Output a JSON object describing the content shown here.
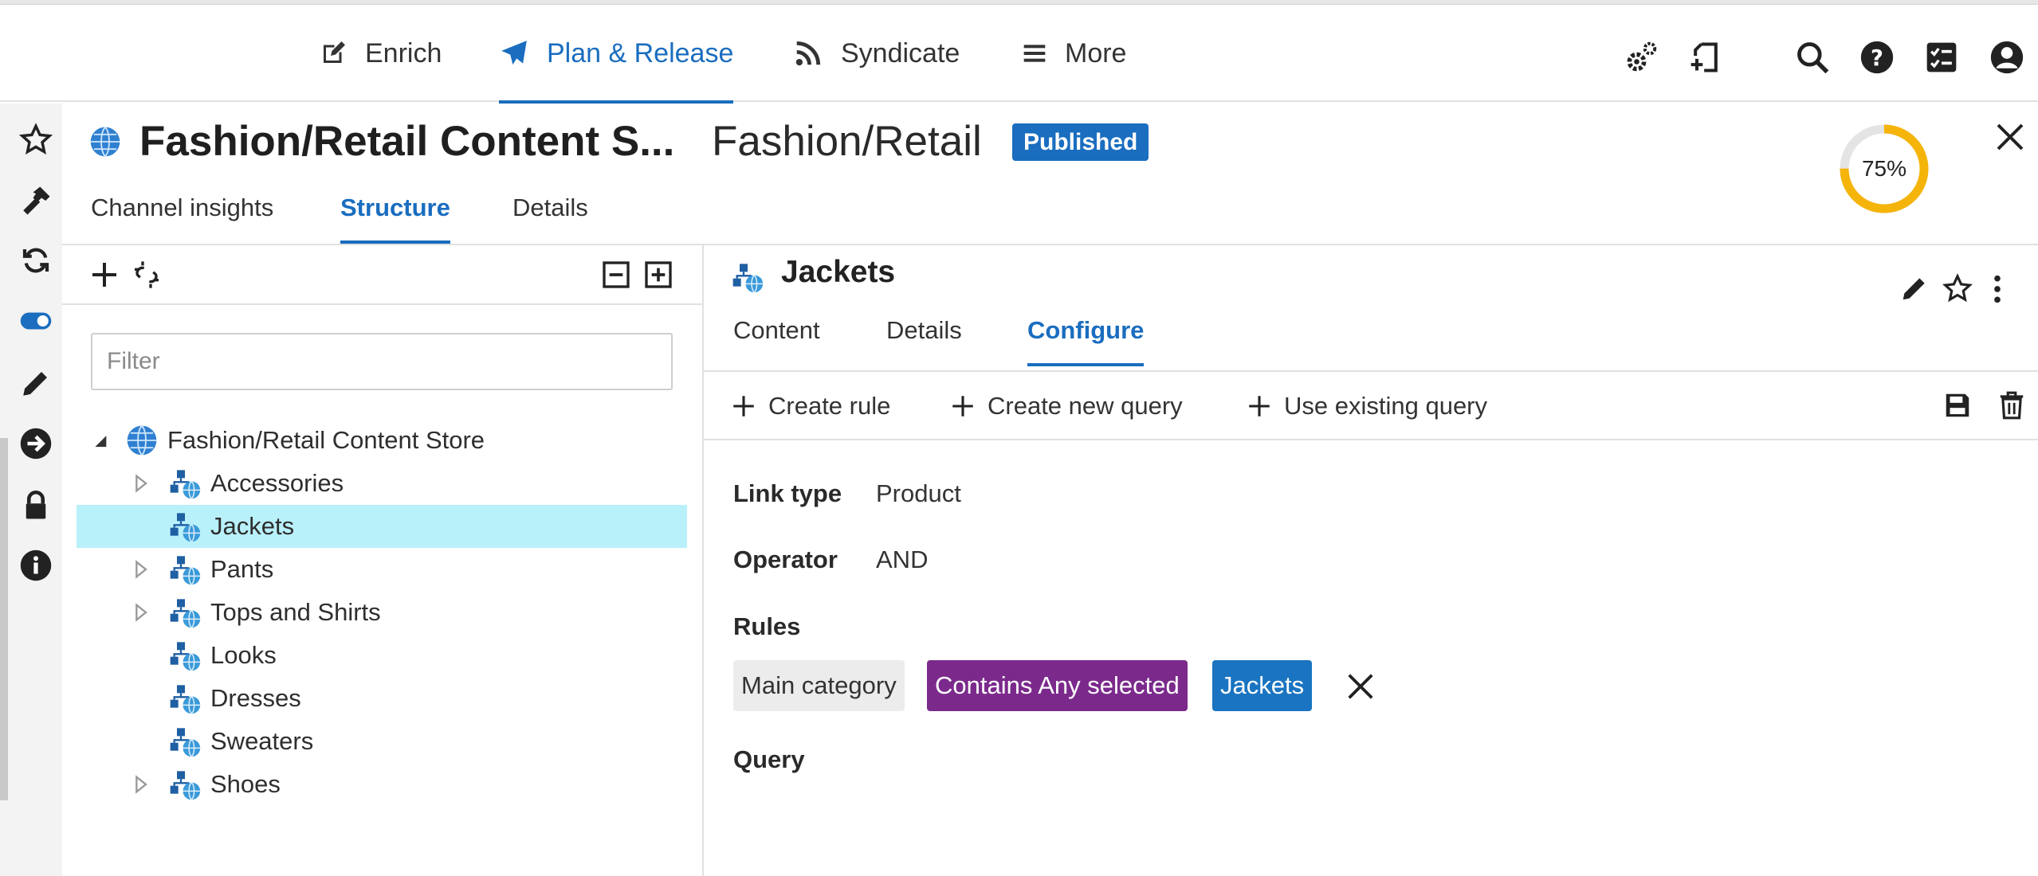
{
  "topnav": {
    "items": [
      {
        "label": "Enrich",
        "icon": "edit-square-icon",
        "active": false
      },
      {
        "label": "Plan & Release",
        "icon": "paper-plane-icon",
        "active": true
      },
      {
        "label": "Syndicate",
        "icon": "rss-icon",
        "active": false
      },
      {
        "label": "More",
        "icon": "hamburger-menu-icon",
        "active": false
      }
    ],
    "utilities": [
      "gears-icon",
      "add-document-icon",
      "search-icon",
      "help-icon",
      "tasks-icon",
      "user-icon"
    ]
  },
  "rail": {
    "icons": [
      "star-icon",
      "hammer-icon",
      "sync-icon",
      "toggle-icon",
      "pencil-icon",
      "arrow-circle-right-icon",
      "lock-icon",
      "info-icon"
    ]
  },
  "header": {
    "title": "Fashion/Retail Content S...",
    "subtitle": "Fashion/Retail",
    "status": "Published",
    "completeness": 75,
    "completeness_label": "75%",
    "tabs": [
      {
        "label": "Channel insights",
        "active": false
      },
      {
        "label": "Structure",
        "active": true
      },
      {
        "label": "Details",
        "active": false
      }
    ]
  },
  "tree": {
    "filter_placeholder": "Filter",
    "filter_value": "",
    "root": {
      "label": "Fashion/Retail Content Store",
      "expanded": true
    },
    "nodes": [
      {
        "label": "Accessories",
        "has_children": true,
        "selected": false
      },
      {
        "label": "Jackets",
        "has_children": false,
        "selected": true
      },
      {
        "label": "Pants",
        "has_children": true,
        "selected": false
      },
      {
        "label": "Tops and Shirts",
        "has_children": true,
        "selected": false
      },
      {
        "label": "Looks",
        "has_children": false,
        "selected": false
      },
      {
        "label": "Dresses",
        "has_children": false,
        "selected": false
      },
      {
        "label": "Sweaters",
        "has_children": false,
        "selected": false
      },
      {
        "label": "Shoes",
        "has_children": true,
        "selected": false
      }
    ]
  },
  "detail": {
    "title": "Jackets",
    "tabs": [
      {
        "label": "Content",
        "active": false
      },
      {
        "label": "Details",
        "active": false
      },
      {
        "label": "Configure",
        "active": true
      }
    ],
    "actions": {
      "create_rule": "Create rule",
      "create_query": "Create new query",
      "use_existing_query": "Use existing query"
    },
    "link_type_label": "Link type",
    "link_type_value": "Product",
    "operator_label": "Operator",
    "operator_value": "AND",
    "rules_label": "Rules",
    "rule": {
      "attribute": "Main category",
      "condition": "Contains Any selected",
      "value": "Jackets"
    },
    "query_label": "Query"
  },
  "colors": {
    "accent": "#1a6dbf",
    "selected_row": "#b9f1fb",
    "progress": "#f5b40a",
    "condition_chip": "#7b2a8c",
    "value_chip": "#1a74c1",
    "attribute_chip": "#ececec"
  }
}
